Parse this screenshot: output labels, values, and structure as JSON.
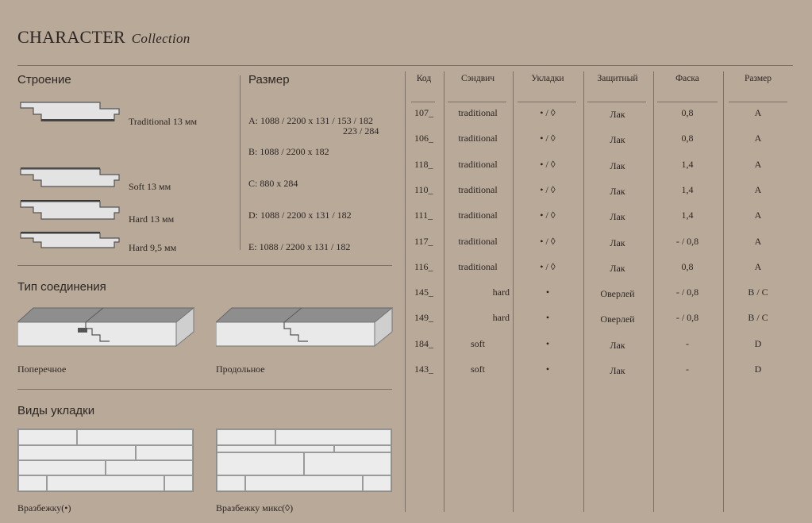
{
  "header": {
    "title_main": "CHARACTER",
    "title_sub": "Collection"
  },
  "structure": {
    "heading": "Строение",
    "items": [
      {
        "label": "Traditional 13 мм"
      },
      {
        "label": "Soft 13 мм"
      },
      {
        "label": "Hard 13 мм"
      },
      {
        "label": "Hard 9,5 мм"
      }
    ]
  },
  "sizes": {
    "heading": "Размер",
    "rows": [
      {
        "line1": "A:  1088 / 2200  x  131 / 153 / 182",
        "line2": "223 / 284"
      },
      {
        "line1": "B:  1088 / 2200  x  182",
        "line2": ""
      },
      {
        "line1": "C:  880   x  284",
        "line2": ""
      },
      {
        "line1": "D:  1088 / 2200  x  131 / 182",
        "line2": ""
      },
      {
        "line1": "E:  1088 / 2200  x  131 / 182",
        "line2": ""
      }
    ]
  },
  "joints": {
    "heading": "Тип соединения",
    "items": [
      {
        "label": "Поперечное"
      },
      {
        "label": "Продольное"
      }
    ]
  },
  "layouts": {
    "heading": "Виды укладки",
    "items": [
      {
        "label": "Вразбежку(•)"
      },
      {
        "label": "Вразбежку микс(◊)"
      }
    ]
  },
  "table": {
    "headers": [
      "Код",
      "Сэндвич",
      "Укладки",
      "Защитный",
      "Фаска",
      "Размер"
    ],
    "rows": [
      [
        "107_",
        "traditional",
        "• / ◊",
        "Лак",
        "0,8",
        "A"
      ],
      [
        "106_",
        "traditional",
        "• / ◊",
        "Лак",
        "0,8",
        "A"
      ],
      [
        "118_",
        "traditional",
        "• / ◊",
        "Лак",
        "1,4",
        "A"
      ],
      [
        "110_",
        "traditional",
        "• / ◊",
        "Лак",
        "1,4",
        "A"
      ],
      [
        "111_",
        "traditional",
        "• / ◊",
        "Лак",
        "1,4",
        "A"
      ],
      [
        "117_",
        "traditional",
        "• / ◊",
        "Лак",
        "- / 0,8",
        "A"
      ],
      [
        "116_",
        "traditional",
        "• / ◊",
        "Лак",
        "0,8",
        "A"
      ],
      [
        "145_",
        "hard",
        "•",
        "Оверлей",
        "- / 0,8",
        "B / C"
      ],
      [
        "149_",
        "hard",
        "•",
        "Оверлей",
        "- / 0,8",
        "B / C"
      ],
      [
        "184_",
        "soft",
        "•",
        "Лак",
        "-",
        "D"
      ],
      [
        "143_",
        "soft",
        "•",
        "Лак",
        "-",
        "D"
      ]
    ]
  }
}
